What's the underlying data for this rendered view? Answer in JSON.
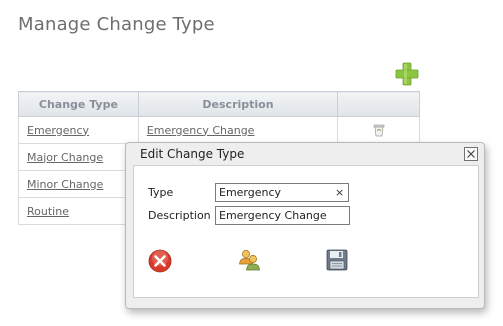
{
  "page": {
    "title": "Manage Change Type"
  },
  "toolbar": {
    "add_icon": "plus-icon"
  },
  "table": {
    "headers": [
      "Change Type",
      "Description",
      ""
    ],
    "rows": [
      {
        "type": "Emergency",
        "description": "Emergency Change",
        "has_delete": true
      },
      {
        "type": "Major Change",
        "description": "",
        "has_delete": false
      },
      {
        "type": "Minor Change",
        "description": "",
        "has_delete": false
      },
      {
        "type": "Routine",
        "description": "",
        "has_delete": false
      }
    ]
  },
  "dialog": {
    "title": "Edit Change Type",
    "type_label": "Type",
    "type_value": "Emergency",
    "clear_glyph": "×",
    "description_label": "Description",
    "description_value": "Emergency Change",
    "actions": {
      "cancel_icon": "cancel-icon",
      "users_icon": "users-icon",
      "save_icon": "save-icon"
    }
  },
  "colors": {
    "accent_green": "#8cc63f",
    "cancel_red": "#d93a2b",
    "header_text": "#8a9099"
  }
}
